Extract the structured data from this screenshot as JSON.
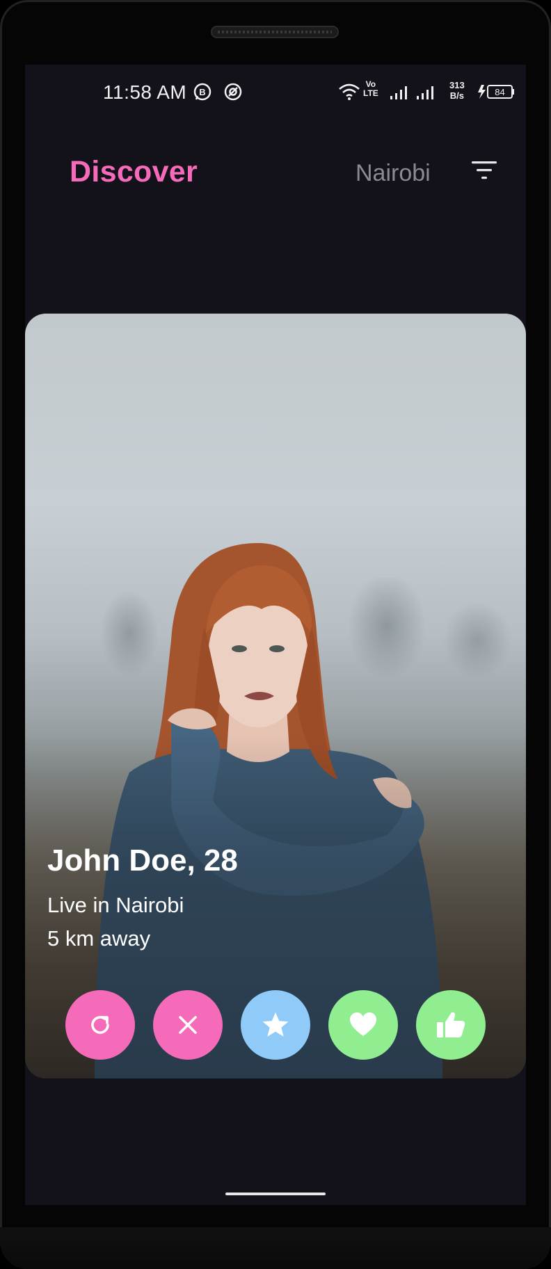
{
  "status_bar": {
    "time": "11:58 AM",
    "volte_top": "Vo",
    "volte_bottom": "LTE",
    "net_speed_value": "313",
    "net_speed_unit": "B/s",
    "battery_level": "84"
  },
  "header": {
    "title": "Discover",
    "location": "Nairobi",
    "filter_icon": "filter-icon"
  },
  "profile": {
    "name_age": "John Doe, 28",
    "lives_in": "Live in Nairobi",
    "distance": "5 km away"
  },
  "actions": [
    {
      "name": "rewind-button",
      "icon": "refresh-icon",
      "color": "#f66bb9"
    },
    {
      "name": "nope-button",
      "icon": "close-icon",
      "color": "#f66bb9"
    },
    {
      "name": "super-like-button",
      "icon": "star-icon",
      "color": "#8fcaf9"
    },
    {
      "name": "like-button",
      "icon": "heart-icon",
      "color": "#90ee90"
    },
    {
      "name": "thumbs-up-button",
      "icon": "thumbs-up-icon",
      "color": "#90ee90"
    }
  ],
  "colors": {
    "accent": "#f66bb9",
    "background": "#131119",
    "location_text": "#8a8a90"
  }
}
